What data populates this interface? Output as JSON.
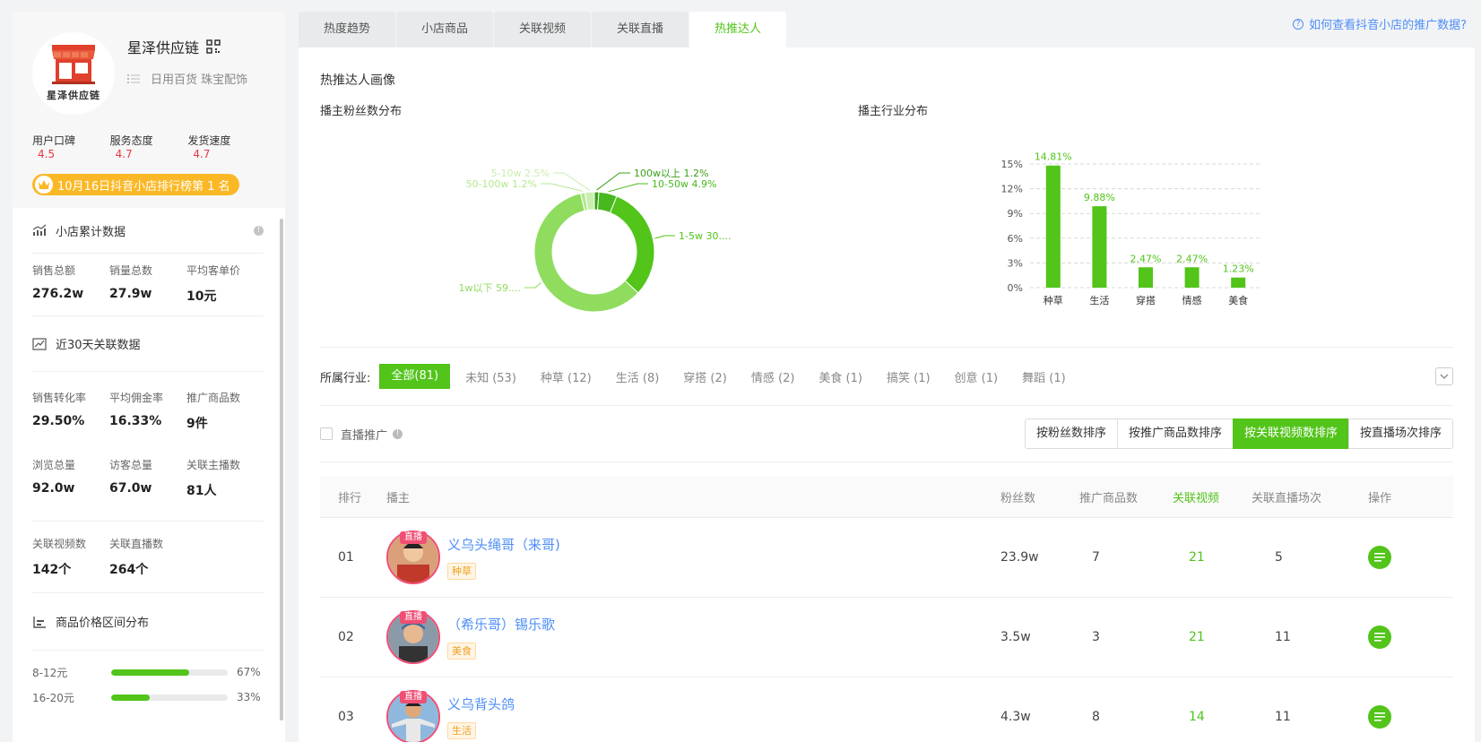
{
  "shop": {
    "name": "星泽供应链",
    "logo_text": "星泽供应链",
    "categories": "日用百货 珠宝配饰",
    "ratings": [
      {
        "label": "用户口碑",
        "value": "4.5"
      },
      {
        "label": "服务态度",
        "value": "4.7"
      },
      {
        "label": "发货速度",
        "value": "4.7"
      }
    ],
    "rank_badge": "10月16日抖音小店排行榜第 1 名"
  },
  "cumulative": {
    "title": "小店累计数据",
    "stats": [
      {
        "label": "销售总额",
        "value": "276.2w"
      },
      {
        "label": "销量总数",
        "value": "27.9w"
      },
      {
        "label": "平均客单价",
        "value": "10元"
      }
    ]
  },
  "recent30": {
    "title": "近30天关联数据",
    "rows": [
      [
        {
          "label": "销售转化率",
          "value": "29.50%"
        },
        {
          "label": "平均佣金率",
          "value": "16.33%"
        },
        {
          "label": "推广商品数",
          "value": "9件"
        }
      ],
      [
        {
          "label": "浏览总量",
          "value": "92.0w"
        },
        {
          "label": "访客总量",
          "value": "67.0w"
        },
        {
          "label": "关联主播数",
          "value": "81人"
        }
      ],
      [
        {
          "label": "关联视频数",
          "value": "142个"
        },
        {
          "label": "关联直播数",
          "value": "264个"
        }
      ]
    ]
  },
  "price_dist": {
    "title": "商品价格区间分布",
    "rows": [
      {
        "label": "8-12元",
        "pct_text": "67%",
        "pct": 0.67
      },
      {
        "label": "16-20元",
        "pct_text": "33%",
        "pct": 0.33
      }
    ]
  },
  "tabs": [
    "热度趋势",
    "小店商品",
    "关联视频",
    "关联直播",
    "热推达人"
  ],
  "active_tab": 4,
  "help_link": "如何查看抖音小店的推广数据?",
  "main_title": "热推达人画像",
  "fans_chart_title": "播主粉丝数分布",
  "industry_chart_title": "播主行业分布",
  "chart_data": [
    {
      "type": "pie",
      "title": "播主粉丝数分布",
      "labels": [
        "100w以上 1.2%",
        "10-50w 4.9%",
        "1-5w 30....",
        "1w以下 59....",
        "50-100w 1.2%",
        "5-10w 2.5%"
      ],
      "values": [
        1.2,
        4.9,
        30.9,
        59.3,
        1.2,
        2.5
      ],
      "colors": [
        "#3aa01a",
        "#48b81f",
        "#52c41a",
        "#8fdc5e",
        "#b4e88f",
        "#c9efaf"
      ]
    },
    {
      "type": "bar",
      "title": "播主行业分布",
      "categories": [
        "种草",
        "生活",
        "穿搭",
        "情感",
        "美食"
      ],
      "values": [
        14.81,
        9.88,
        2.47,
        2.47,
        1.23
      ],
      "value_labels": [
        "14.81%",
        "9.88%",
        "2.47%",
        "2.47%",
        "1.23%"
      ],
      "ylim": [
        0,
        15
      ],
      "yticks": [
        "0%",
        "3%",
        "6%",
        "9%",
        "12%",
        "15%"
      ],
      "color": "#52c41a"
    }
  ],
  "filter": {
    "label": "所属行业:",
    "chips": [
      "全部(81)",
      "未知 (53)",
      "种草 (12)",
      "生活 (8)",
      "穿搭 (2)",
      "情感 (2)",
      "美食 (1)",
      "搞笑 (1)",
      "创意 (1)",
      "舞蹈 (1)"
    ],
    "active": 0
  },
  "options": {
    "live_promo_label": "直播推广",
    "sort_buttons": [
      "按粉丝数排序",
      "按推广商品数排序",
      "按关联视频数排序",
      "按直播场次排序"
    ],
    "active_sort": 2
  },
  "table": {
    "headers": [
      "排行",
      "播主",
      "粉丝数",
      "推广商品数",
      "关联视频",
      "关联直播场次",
      "操作"
    ],
    "live_tag": "直播",
    "rows": [
      {
        "rank": "01",
        "name": "义乌头绳哥（来哥)",
        "tag": "种草",
        "fans": "23.9w",
        "goods": "7",
        "videos": "21",
        "lives": "5"
      },
      {
        "rank": "02",
        "name": "（希乐哥）锡乐歌",
        "tag": "美食",
        "fans": "3.5w",
        "goods": "3",
        "videos": "21",
        "lives": "11"
      },
      {
        "rank": "03",
        "name": "义乌背头鸽",
        "tag": "生活",
        "fans": "4.3w",
        "goods": "8",
        "videos": "14",
        "lives": "11"
      }
    ]
  }
}
